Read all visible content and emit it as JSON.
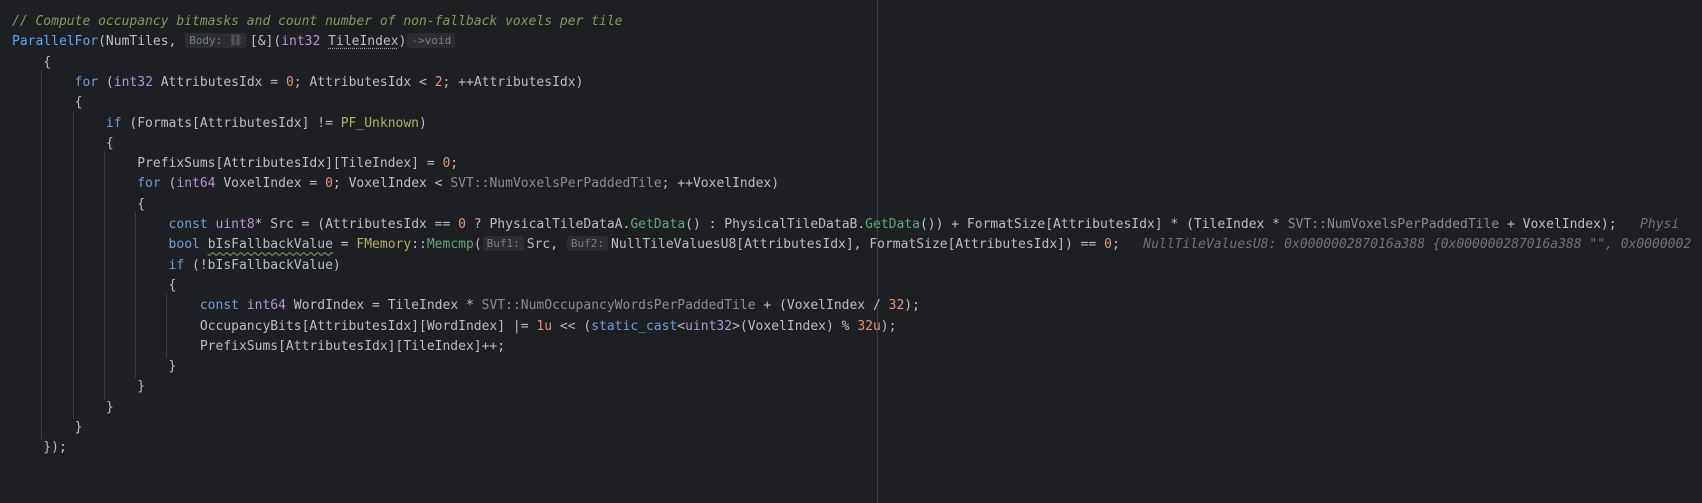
{
  "colors": {
    "background": "#1e1f22",
    "default": "#bcbec4",
    "comment": "#7a9e5a",
    "keyword": "#cf8e6d",
    "keyword_blue": "#6f9fd8",
    "type": "#b893d6",
    "function": "#57aaf7",
    "method": "#5ea878",
    "number": "#e0957a",
    "macro": "#b3ae60",
    "namespace": "#8c8c8c",
    "hint": "#7a7e85"
  },
  "lines": [
    [
      [
        "comment",
        "// Compute occupancy bitmasks and count number of non-fallback voxels per tile"
      ]
    ],
    [
      [
        "func",
        "ParallelFor"
      ],
      [
        "d",
        "(NumTiles, "
      ],
      [
        "hint",
        "Body: ⛓"
      ],
      [
        "d",
        "[&]("
      ],
      [
        "type",
        "int32"
      ],
      [
        "d",
        " "
      ],
      [
        "ul",
        "TileIndex"
      ],
      [
        "d",
        ")"
      ],
      [
        "hint",
        "->void"
      ]
    ],
    [
      [
        "d",
        "    {"
      ]
    ],
    [
      [
        "d",
        "        "
      ],
      [
        "kwb",
        "for"
      ],
      [
        "d",
        " ("
      ],
      [
        "type",
        "int32"
      ],
      [
        "d",
        " AttributesIdx = "
      ],
      [
        "num",
        "0"
      ],
      [
        "d",
        "; AttributesIdx < "
      ],
      [
        "num",
        "2"
      ],
      [
        "d",
        "; ++AttributesIdx)"
      ]
    ],
    [
      [
        "d",
        "        {"
      ]
    ],
    [
      [
        "d",
        "            "
      ],
      [
        "kwb",
        "if"
      ],
      [
        "d",
        " (Formats[AttributesIdx] != "
      ],
      [
        "macro",
        "PF_Unknown"
      ],
      [
        "d",
        ")"
      ]
    ],
    [
      [
        "d",
        "            {"
      ]
    ],
    [
      [
        "d",
        "                PrefixSums[AttributesIdx][TileIndex] = "
      ],
      [
        "num",
        "0"
      ],
      [
        "d",
        ";"
      ]
    ],
    [
      [
        "d",
        "                "
      ],
      [
        "kwb",
        "for"
      ],
      [
        "d",
        " ("
      ],
      [
        "type",
        "int64"
      ],
      [
        "d",
        " VoxelIndex = "
      ],
      [
        "num",
        "0"
      ],
      [
        "d",
        "; VoxelIndex < "
      ],
      [
        "ns",
        "SVT::NumVoxelsPerPaddedTile"
      ],
      [
        "d",
        "; ++VoxelIndex)"
      ]
    ],
    [
      [
        "d",
        "                {"
      ]
    ],
    [
      [
        "d",
        "                    "
      ],
      [
        "kwb",
        "const"
      ],
      [
        "d",
        " "
      ],
      [
        "type",
        "uint8"
      ],
      [
        "d",
        "* Src = (AttributesIdx == "
      ],
      [
        "num",
        "0"
      ],
      [
        "d",
        " ? PhysicalTileDataA."
      ],
      [
        "meth",
        "GetData"
      ],
      [
        "d",
        "() : PhysicalTileDataB."
      ],
      [
        "meth",
        "GetData"
      ],
      [
        "d",
        "()) + FormatSize[AttributesIdx] * (TileIndex * "
      ],
      [
        "ns",
        "SVT::NumVoxelsPerPaddedTile"
      ],
      [
        "d",
        " + VoxelIndex);  "
      ],
      [
        "dbg",
        " Physi"
      ]
    ],
    [
      [
        "d",
        "                    "
      ],
      [
        "kwb",
        "bool"
      ],
      [
        "d",
        " "
      ],
      [
        "sq",
        "bIsFallbackValue"
      ],
      [
        "d",
        " = "
      ],
      [
        "macro",
        "FMemory"
      ],
      [
        "d",
        "::"
      ],
      [
        "meth",
        "Memcmp"
      ],
      [
        "d",
        "("
      ],
      [
        "hint",
        "Buf1:"
      ],
      [
        "d",
        "Src, "
      ],
      [
        "hint",
        "Buf2:"
      ],
      [
        "d",
        "NullTileValuesU8[AttributesIdx], FormatSize[AttributesIdx]) == "
      ],
      [
        "num",
        "0"
      ],
      [
        "d",
        ";  "
      ],
      [
        "dbg",
        " NullTileValuesU8: 0x000000287016a388 {0x000000287016a388 \"\", 0x0000002"
      ]
    ],
    [
      [
        "d",
        "                    "
      ],
      [
        "kwb",
        "if"
      ],
      [
        "d",
        " (!bIsFallbackValue)"
      ]
    ],
    [
      [
        "d",
        "                    {"
      ]
    ],
    [
      [
        "d",
        "                        "
      ],
      [
        "kwb",
        "const"
      ],
      [
        "d",
        " "
      ],
      [
        "type",
        "int64"
      ],
      [
        "d",
        " WordIndex = TileIndex * "
      ],
      [
        "ns",
        "SVT::NumOccupancyWordsPerPaddedTile"
      ],
      [
        "d",
        " + (VoxelIndex / "
      ],
      [
        "num",
        "32"
      ],
      [
        "d",
        ");"
      ]
    ],
    [
      [
        "d",
        "                        OccupancyBits[AttributesIdx][WordIndex] |= "
      ],
      [
        "num",
        "1u"
      ],
      [
        "d",
        " << ("
      ],
      [
        "kwb",
        "static_cast"
      ],
      [
        "d",
        "<"
      ],
      [
        "type",
        "uint32"
      ],
      [
        "d",
        ">(VoxelIndex) % "
      ],
      [
        "num",
        "32u"
      ],
      [
        "d",
        ");"
      ]
    ],
    [
      [
        "d",
        "                        PrefixSums[AttributesIdx][TileIndex]++;"
      ]
    ],
    [
      [
        "d",
        "                    }"
      ]
    ],
    [
      [
        "d",
        "                }"
      ]
    ],
    [
      [
        "d",
        "            }"
      ]
    ],
    [
      [
        "d",
        "        }"
      ]
    ],
    [
      [
        "d",
        "    });"
      ]
    ]
  ]
}
